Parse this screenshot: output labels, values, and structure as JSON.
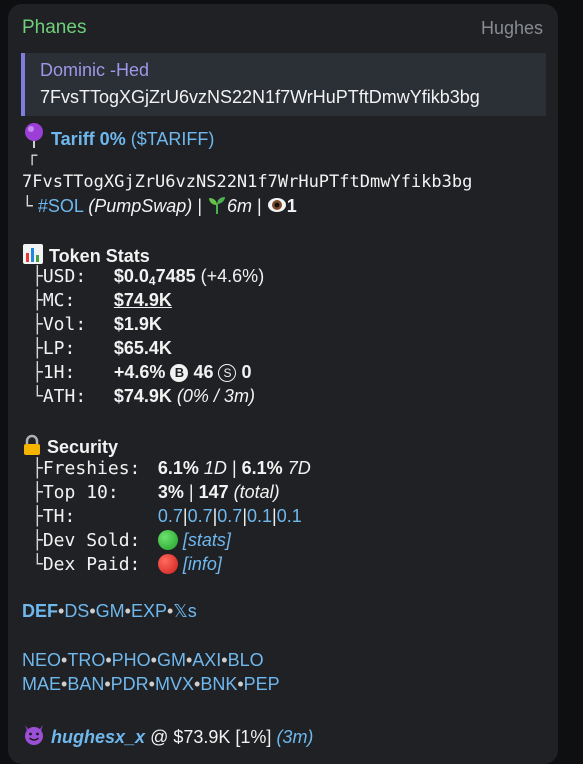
{
  "header": {
    "sender": "Phanes",
    "via": "Hughes"
  },
  "reply": {
    "name": "Dominic -Hed",
    "text": "7FvsTTogXGjZrU6vzNS22N1f7WrHuPTftDmwYfikb3bg"
  },
  "token": {
    "name_line": "Tariff 0%",
    "ticker": "($TARIFF)",
    "tree_top": "┌",
    "address": "7FvsTTogXGjZrU6vzNS22N1f7WrHuPTftDmwYfikb3bg",
    "tree_end": "└",
    "chain_tag": "#SOL",
    "dex": "(PumpSwap)",
    "sep": "|",
    "age": "6m",
    "eyes": "1"
  },
  "stats": {
    "title": "Token Stats",
    "rows": [
      {
        "branch": "├",
        "label": "USD:",
        "v1": "$0.0",
        "v_sub": "4",
        "v2": "7485",
        "v3": "(+4.6%)"
      },
      {
        "branch": "├",
        "label": "MC:",
        "value": "$74.9K"
      },
      {
        "branch": "├",
        "label": "Vol:",
        "value": "$1.9K"
      },
      {
        "branch": "├",
        "label": "LP:",
        "value": "$65.4K"
      },
      {
        "branch": "├",
        "label": "1H:",
        "pct": "+4.6%",
        "b_icon": "B",
        "b_val": "46",
        "s_icon": "S",
        "s_val": "0"
      },
      {
        "branch": "└",
        "label": "ATH:",
        "value": "$74.9K",
        "extra": "(0% / 3m)"
      }
    ]
  },
  "security": {
    "title": "Security",
    "freshies_label": "Freshies:",
    "freshies_v1": "6.1%",
    "freshies_p1": "1D",
    "freshies_sep": "|",
    "freshies_v2": "6.1%",
    "freshies_p2": "7D",
    "top10_label": "Top 10:",
    "top10_v": "3%",
    "top10_sep": "|",
    "top10_n": "147",
    "top10_total": "(total)",
    "th_label": "TH:",
    "th_values": [
      "0.7",
      "0.7",
      "0.7",
      "0.1",
      "0.1"
    ],
    "dev_label": "Dev Sold:",
    "dev_link": "[stats]",
    "dex_label": "Dex Paid:",
    "dex_link": "[info]",
    "branches": [
      "├",
      "├",
      "├",
      "├",
      "└"
    ]
  },
  "links": {
    "row1": [
      "DEF",
      "DS",
      "GM",
      "EXP",
      "𝕏s"
    ],
    "row2": [
      "NEO",
      "TRO",
      "PHO",
      "GM",
      "AXI",
      "BLO"
    ],
    "row3": [
      "MAE",
      "BAN",
      "PDR",
      "MVX",
      "BNK",
      "PEP"
    ],
    "dot": "•"
  },
  "caller": {
    "name": "hughesx_x",
    "at": "@ $73.9K [1%]",
    "time": "(3m)"
  },
  "colors": {
    "sender": "#6fd07a",
    "link": "#6fb8ee",
    "reply_bar": "#7f7ee0",
    "bubble": "#1f2124"
  }
}
